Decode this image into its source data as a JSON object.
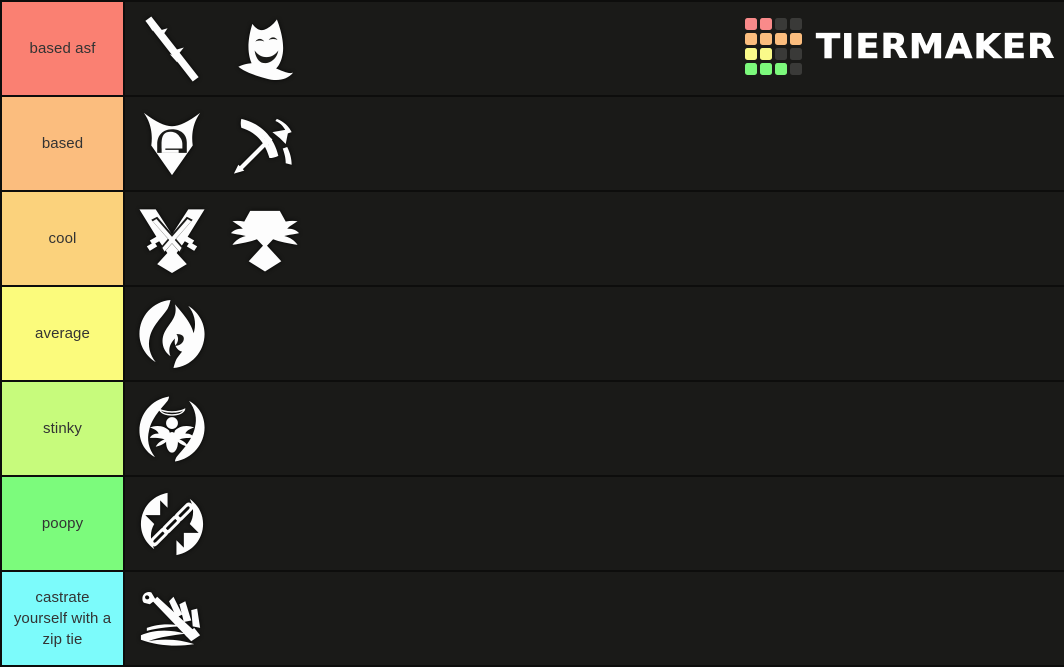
{
  "brand": {
    "name": "TIERMAKER",
    "grid_colors": [
      [
        "#f98a8a",
        "#f98a8a",
        "#3a3a38",
        "#3a3a38"
      ],
      [
        "#fbbd7e",
        "#fbbd7e",
        "#fbbd7e",
        "#fbbd7e"
      ],
      [
        "#fafa8a",
        "#fafa8a",
        "#3a3a38",
        "#3a3a38"
      ],
      [
        "#7cf97c",
        "#7cf97c",
        "#7cf97c",
        "#3a3a38"
      ]
    ]
  },
  "canvas": {
    "background": "#1a1a18",
    "row_divider": "#0d0d0c",
    "label_text_color": "#333333",
    "icon_color": "#fdfdfd"
  },
  "tiers": [
    {
      "label": "based asf",
      "color": "#fa8072",
      "items": [
        {
          "icon": "thorny-stick-icon",
          "name": "thorny-stick"
        },
        {
          "icon": "comedy-mask-icon",
          "name": "comedy-mask"
        }
      ]
    },
    {
      "label": "based",
      "color": "#fbbd7e",
      "items": [
        {
          "icon": "knight-shield-icon",
          "name": "knight-shield"
        },
        {
          "icon": "bow-and-arrow-icon",
          "name": "bow-and-arrow"
        }
      ]
    },
    {
      "label": "cool",
      "color": "#fbd27c",
      "items": [
        {
          "icon": "crossed-swords-badge-icon",
          "name": "crossed-swords-badge"
        },
        {
          "icon": "winged-badge-icon",
          "name": "winged-badge"
        }
      ]
    },
    {
      "label": "average",
      "color": "#fbfb7c",
      "items": [
        {
          "icon": "flame-circle-icon",
          "name": "flame-circle"
        }
      ]
    },
    {
      "label": "stinky",
      "color": "#c7fb7c",
      "items": [
        {
          "icon": "angel-circle-icon",
          "name": "angel-circle"
        }
      ]
    },
    {
      "label": "poopy",
      "color": "#7cfb7c",
      "items": [
        {
          "icon": "chain-circle-icon",
          "name": "chain-circle"
        }
      ]
    },
    {
      "label": "castrate yourself with a zip tie",
      "color": "#7cfbfb",
      "items": [
        {
          "icon": "dagger-slash-icon",
          "name": "dagger-slash"
        }
      ]
    }
  ]
}
